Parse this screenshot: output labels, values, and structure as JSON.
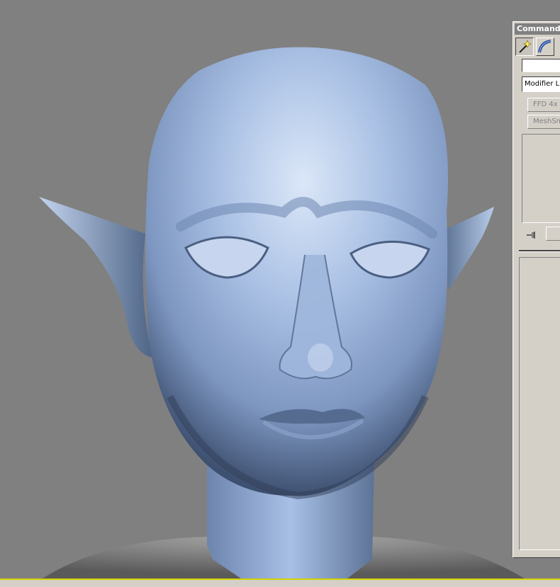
{
  "viewport": {
    "background": "#808080",
    "object_color": "#9eb6dc"
  },
  "command_panel": {
    "title": "Command",
    "tabs": [
      {
        "icon": "create-wand-icon"
      },
      {
        "icon": "modify-bend-icon"
      }
    ],
    "name_value": "",
    "modifier_list": "Modifier Lis",
    "modifiers": [
      "FFD 4x",
      "MeshSm"
    ],
    "pin_icon": "pin-stack-icon"
  },
  "colors": {
    "panel": "#d4d0c8",
    "accent_border": "#d4d400"
  }
}
